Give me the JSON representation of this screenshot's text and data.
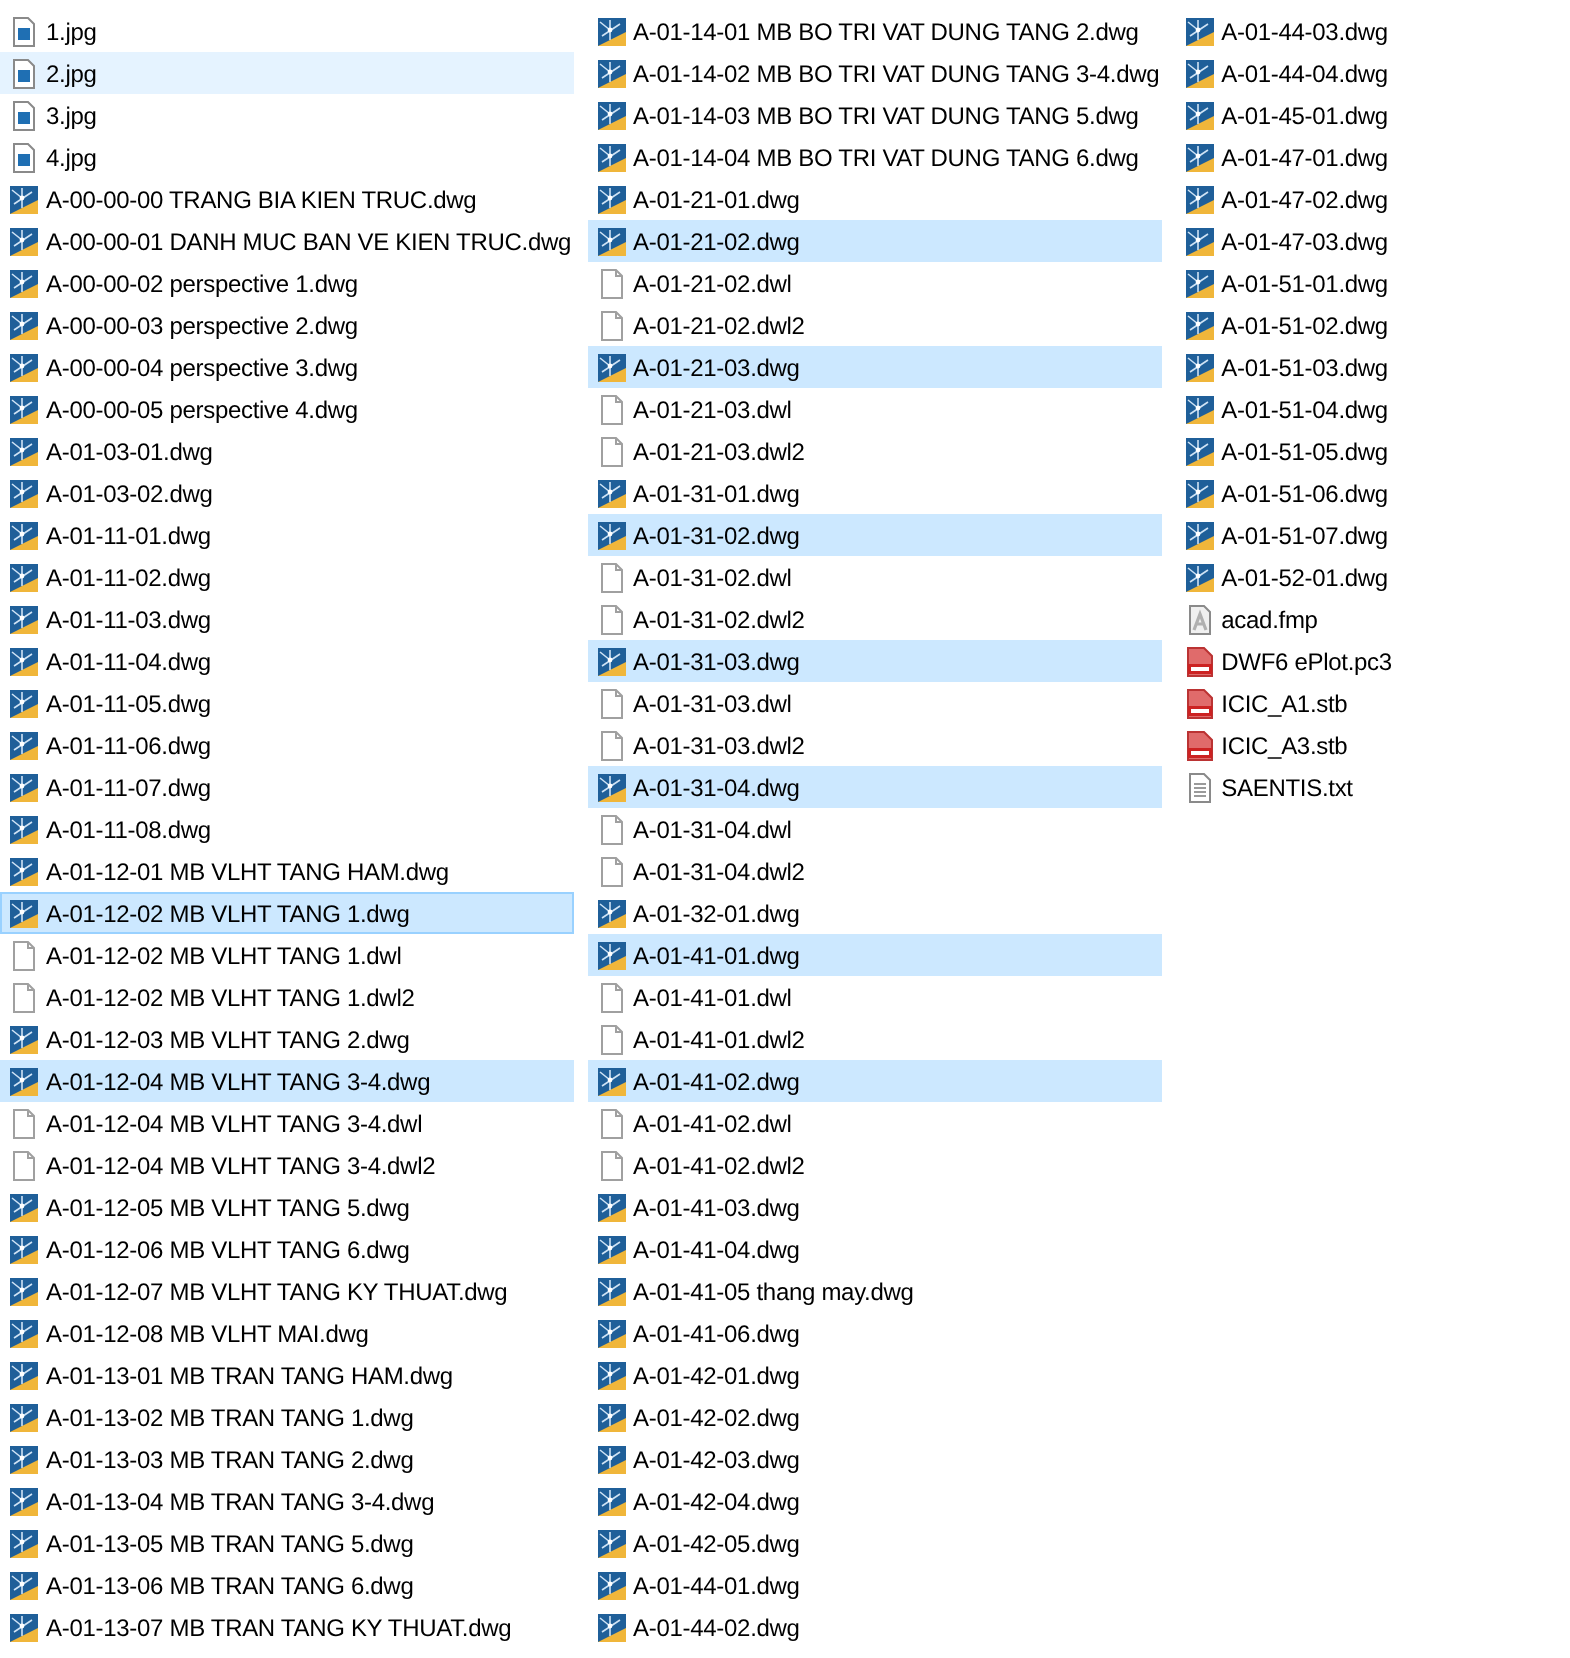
{
  "columns": [
    {
      "items": [
        {
          "name": "1.jpg",
          "kind": "image",
          "selected": false,
          "hovered": false,
          "focused": false
        },
        {
          "name": "2.jpg",
          "kind": "image",
          "selected": false,
          "hovered": true,
          "focused": false
        },
        {
          "name": "3.jpg",
          "kind": "image",
          "selected": false,
          "hovered": false,
          "focused": false
        },
        {
          "name": "4.jpg",
          "kind": "image",
          "selected": false,
          "hovered": false,
          "focused": false
        },
        {
          "name": "A-00-00-00 TRANG BIA KIEN TRUC.dwg",
          "kind": "dwg",
          "selected": false,
          "hovered": false,
          "focused": false
        },
        {
          "name": "A-00-00-01 DANH MUC BAN VE KIEN TRUC.dwg",
          "kind": "dwg",
          "selected": false,
          "hovered": false,
          "focused": false
        },
        {
          "name": "A-00-00-02 perspective 1.dwg",
          "kind": "dwg",
          "selected": false,
          "hovered": false,
          "focused": false
        },
        {
          "name": "A-00-00-03 perspective 2.dwg",
          "kind": "dwg",
          "selected": false,
          "hovered": false,
          "focused": false
        },
        {
          "name": "A-00-00-04 perspective 3.dwg",
          "kind": "dwg",
          "selected": false,
          "hovered": false,
          "focused": false
        },
        {
          "name": "A-00-00-05 perspective 4.dwg",
          "kind": "dwg",
          "selected": false,
          "hovered": false,
          "focused": false
        },
        {
          "name": "A-01-03-01.dwg",
          "kind": "dwg",
          "selected": false,
          "hovered": false,
          "focused": false
        },
        {
          "name": "A-01-03-02.dwg",
          "kind": "dwg",
          "selected": false,
          "hovered": false,
          "focused": false
        },
        {
          "name": "A-01-11-01.dwg",
          "kind": "dwg",
          "selected": false,
          "hovered": false,
          "focused": false
        },
        {
          "name": "A-01-11-02.dwg",
          "kind": "dwg",
          "selected": false,
          "hovered": false,
          "focused": false
        },
        {
          "name": "A-01-11-03.dwg",
          "kind": "dwg",
          "selected": false,
          "hovered": false,
          "focused": false
        },
        {
          "name": "A-01-11-04.dwg",
          "kind": "dwg",
          "selected": false,
          "hovered": false,
          "focused": false
        },
        {
          "name": "A-01-11-05.dwg",
          "kind": "dwg",
          "selected": false,
          "hovered": false,
          "focused": false
        },
        {
          "name": "A-01-11-06.dwg",
          "kind": "dwg",
          "selected": false,
          "hovered": false,
          "focused": false
        },
        {
          "name": "A-01-11-07.dwg",
          "kind": "dwg",
          "selected": false,
          "hovered": false,
          "focused": false
        },
        {
          "name": "A-01-11-08.dwg",
          "kind": "dwg",
          "selected": false,
          "hovered": false,
          "focused": false
        },
        {
          "name": "A-01-12-01 MB VLHT TANG HAM.dwg",
          "kind": "dwg",
          "selected": false,
          "hovered": false,
          "focused": false
        },
        {
          "name": "A-01-12-02 MB VLHT TANG 1.dwg",
          "kind": "dwg",
          "selected": true,
          "hovered": false,
          "focused": true
        },
        {
          "name": "A-01-12-02 MB VLHT TANG 1.dwl",
          "kind": "blank",
          "selected": false,
          "hovered": false,
          "focused": false
        },
        {
          "name": "A-01-12-02 MB VLHT TANG 1.dwl2",
          "kind": "blank",
          "selected": false,
          "hovered": false,
          "focused": false
        },
        {
          "name": "A-01-12-03 MB VLHT TANG 2.dwg",
          "kind": "dwg",
          "selected": false,
          "hovered": false,
          "focused": false
        },
        {
          "name": "A-01-12-04 MB VLHT TANG 3-4.dwg",
          "kind": "dwg",
          "selected": true,
          "hovered": false,
          "focused": false
        },
        {
          "name": "A-01-12-04 MB VLHT TANG 3-4.dwl",
          "kind": "blank",
          "selected": false,
          "hovered": false,
          "focused": false
        },
        {
          "name": "A-01-12-04 MB VLHT TANG 3-4.dwl2",
          "kind": "blank",
          "selected": false,
          "hovered": false,
          "focused": false
        },
        {
          "name": "A-01-12-05 MB VLHT TANG 5.dwg",
          "kind": "dwg",
          "selected": false,
          "hovered": false,
          "focused": false
        },
        {
          "name": "A-01-12-06 MB VLHT TANG 6.dwg",
          "kind": "dwg",
          "selected": false,
          "hovered": false,
          "focused": false
        },
        {
          "name": "A-01-12-07 MB VLHT TANG KY THUAT.dwg",
          "kind": "dwg",
          "selected": false,
          "hovered": false,
          "focused": false
        },
        {
          "name": "A-01-12-08 MB VLHT MAI.dwg",
          "kind": "dwg",
          "selected": false,
          "hovered": false,
          "focused": false
        },
        {
          "name": "A-01-13-01 MB TRAN TANG HAM.dwg",
          "kind": "dwg",
          "selected": false,
          "hovered": false,
          "focused": false
        },
        {
          "name": "A-01-13-02 MB TRAN TANG 1.dwg",
          "kind": "dwg",
          "selected": false,
          "hovered": false,
          "focused": false
        },
        {
          "name": "A-01-13-03 MB TRAN TANG 2.dwg",
          "kind": "dwg",
          "selected": false,
          "hovered": false,
          "focused": false
        },
        {
          "name": "A-01-13-04 MB TRAN TANG 3-4.dwg",
          "kind": "dwg",
          "selected": false,
          "hovered": false,
          "focused": false
        },
        {
          "name": "A-01-13-05 MB TRAN TANG 5.dwg",
          "kind": "dwg",
          "selected": false,
          "hovered": false,
          "focused": false
        },
        {
          "name": "A-01-13-06 MB TRAN TANG 6.dwg",
          "kind": "dwg",
          "selected": false,
          "hovered": false,
          "focused": false
        },
        {
          "name": "A-01-13-07 MB TRAN TANG KY THUAT.dwg",
          "kind": "dwg",
          "selected": false,
          "hovered": false,
          "focused": false
        }
      ]
    },
    {
      "items": [
        {
          "name": "A-01-14-01 MB BO TRI VAT DUNG TANG 2.dwg",
          "kind": "dwg",
          "selected": false,
          "hovered": false,
          "focused": false
        },
        {
          "name": "A-01-14-02 MB BO TRI VAT DUNG TANG 3-4.dwg",
          "kind": "dwg",
          "selected": false,
          "hovered": false,
          "focused": false
        },
        {
          "name": "A-01-14-03 MB BO TRI VAT DUNG TANG 5.dwg",
          "kind": "dwg",
          "selected": false,
          "hovered": false,
          "focused": false
        },
        {
          "name": "A-01-14-04 MB BO TRI VAT DUNG TANG 6.dwg",
          "kind": "dwg",
          "selected": false,
          "hovered": false,
          "focused": false
        },
        {
          "name": "A-01-21-01.dwg",
          "kind": "dwg",
          "selected": false,
          "hovered": false,
          "focused": false
        },
        {
          "name": "A-01-21-02.dwg",
          "kind": "dwg",
          "selected": true,
          "hovered": false,
          "focused": false
        },
        {
          "name": "A-01-21-02.dwl",
          "kind": "blank",
          "selected": false,
          "hovered": false,
          "focused": false
        },
        {
          "name": "A-01-21-02.dwl2",
          "kind": "blank",
          "selected": false,
          "hovered": false,
          "focused": false
        },
        {
          "name": "A-01-21-03.dwg",
          "kind": "dwg",
          "selected": true,
          "hovered": false,
          "focused": false
        },
        {
          "name": "A-01-21-03.dwl",
          "kind": "blank",
          "selected": false,
          "hovered": false,
          "focused": false
        },
        {
          "name": "A-01-21-03.dwl2",
          "kind": "blank",
          "selected": false,
          "hovered": false,
          "focused": false
        },
        {
          "name": "A-01-31-01.dwg",
          "kind": "dwg",
          "selected": false,
          "hovered": false,
          "focused": false
        },
        {
          "name": "A-01-31-02.dwg",
          "kind": "dwg",
          "selected": true,
          "hovered": false,
          "focused": false
        },
        {
          "name": "A-01-31-02.dwl",
          "kind": "blank",
          "selected": false,
          "hovered": false,
          "focused": false
        },
        {
          "name": "A-01-31-02.dwl2",
          "kind": "blank",
          "selected": false,
          "hovered": false,
          "focused": false
        },
        {
          "name": "A-01-31-03.dwg",
          "kind": "dwg",
          "selected": true,
          "hovered": false,
          "focused": false
        },
        {
          "name": "A-01-31-03.dwl",
          "kind": "blank",
          "selected": false,
          "hovered": false,
          "focused": false
        },
        {
          "name": "A-01-31-03.dwl2",
          "kind": "blank",
          "selected": false,
          "hovered": false,
          "focused": false
        },
        {
          "name": "A-01-31-04.dwg",
          "kind": "dwg",
          "selected": true,
          "hovered": false,
          "focused": false
        },
        {
          "name": "A-01-31-04.dwl",
          "kind": "blank",
          "selected": false,
          "hovered": false,
          "focused": false
        },
        {
          "name": "A-01-31-04.dwl2",
          "kind": "blank",
          "selected": false,
          "hovered": false,
          "focused": false
        },
        {
          "name": "A-01-32-01.dwg",
          "kind": "dwg",
          "selected": false,
          "hovered": false,
          "focused": false
        },
        {
          "name": "A-01-41-01.dwg",
          "kind": "dwg",
          "selected": true,
          "hovered": false,
          "focused": false
        },
        {
          "name": "A-01-41-01.dwl",
          "kind": "blank",
          "selected": false,
          "hovered": false,
          "focused": false
        },
        {
          "name": "A-01-41-01.dwl2",
          "kind": "blank",
          "selected": false,
          "hovered": false,
          "focused": false
        },
        {
          "name": "A-01-41-02.dwg",
          "kind": "dwg",
          "selected": true,
          "hovered": false,
          "focused": false
        },
        {
          "name": "A-01-41-02.dwl",
          "kind": "blank",
          "selected": false,
          "hovered": false,
          "focused": false
        },
        {
          "name": "A-01-41-02.dwl2",
          "kind": "blank",
          "selected": false,
          "hovered": false,
          "focused": false
        },
        {
          "name": "A-01-41-03.dwg",
          "kind": "dwg",
          "selected": false,
          "hovered": false,
          "focused": false
        },
        {
          "name": "A-01-41-04.dwg",
          "kind": "dwg",
          "selected": false,
          "hovered": false,
          "focused": false
        },
        {
          "name": "A-01-41-05 thang may.dwg",
          "kind": "dwg",
          "selected": false,
          "hovered": false,
          "focused": false
        },
        {
          "name": "A-01-41-06.dwg",
          "kind": "dwg",
          "selected": false,
          "hovered": false,
          "focused": false
        },
        {
          "name": "A-01-42-01.dwg",
          "kind": "dwg",
          "selected": false,
          "hovered": false,
          "focused": false
        },
        {
          "name": "A-01-42-02.dwg",
          "kind": "dwg",
          "selected": false,
          "hovered": false,
          "focused": false
        },
        {
          "name": "A-01-42-03.dwg",
          "kind": "dwg",
          "selected": false,
          "hovered": false,
          "focused": false
        },
        {
          "name": "A-01-42-04.dwg",
          "kind": "dwg",
          "selected": false,
          "hovered": false,
          "focused": false
        },
        {
          "name": "A-01-42-05.dwg",
          "kind": "dwg",
          "selected": false,
          "hovered": false,
          "focused": false
        },
        {
          "name": "A-01-44-01.dwg",
          "kind": "dwg",
          "selected": false,
          "hovered": false,
          "focused": false
        },
        {
          "name": "A-01-44-02.dwg",
          "kind": "dwg",
          "selected": false,
          "hovered": false,
          "focused": false
        }
      ]
    },
    {
      "items": [
        {
          "name": "A-01-44-03.dwg",
          "kind": "dwg",
          "selected": false,
          "hovered": false,
          "focused": false
        },
        {
          "name": "A-01-44-04.dwg",
          "kind": "dwg",
          "selected": false,
          "hovered": false,
          "focused": false
        },
        {
          "name": "A-01-45-01.dwg",
          "kind": "dwg",
          "selected": false,
          "hovered": false,
          "focused": false
        },
        {
          "name": "A-01-47-01.dwg",
          "kind": "dwg",
          "selected": false,
          "hovered": false,
          "focused": false
        },
        {
          "name": "A-01-47-02.dwg",
          "kind": "dwg",
          "selected": false,
          "hovered": false,
          "focused": false
        },
        {
          "name": "A-01-47-03.dwg",
          "kind": "dwg",
          "selected": false,
          "hovered": false,
          "focused": false
        },
        {
          "name": "A-01-51-01.dwg",
          "kind": "dwg",
          "selected": false,
          "hovered": false,
          "focused": false
        },
        {
          "name": "A-01-51-02.dwg",
          "kind": "dwg",
          "selected": false,
          "hovered": false,
          "focused": false
        },
        {
          "name": "A-01-51-03.dwg",
          "kind": "dwg",
          "selected": false,
          "hovered": false,
          "focused": false
        },
        {
          "name": "A-01-51-04.dwg",
          "kind": "dwg",
          "selected": false,
          "hovered": false,
          "focused": false
        },
        {
          "name": "A-01-51-05.dwg",
          "kind": "dwg",
          "selected": false,
          "hovered": false,
          "focused": false
        },
        {
          "name": "A-01-51-06.dwg",
          "kind": "dwg",
          "selected": false,
          "hovered": false,
          "focused": false
        },
        {
          "name": "A-01-51-07.dwg",
          "kind": "dwg",
          "selected": false,
          "hovered": false,
          "focused": false
        },
        {
          "name": "A-01-52-01.dwg",
          "kind": "dwg",
          "selected": false,
          "hovered": false,
          "focused": false
        },
        {
          "name": "acad.fmp",
          "kind": "font",
          "selected": false,
          "hovered": false,
          "focused": false
        },
        {
          "name": "DWF6 ePlot.pc3",
          "kind": "pc3",
          "selected": false,
          "hovered": false,
          "focused": false
        },
        {
          "name": "ICIC_A1.stb",
          "kind": "stb",
          "selected": false,
          "hovered": false,
          "focused": false
        },
        {
          "name": "ICIC_A3.stb",
          "kind": "stb",
          "selected": false,
          "hovered": false,
          "focused": false
        },
        {
          "name": "SAENTIS.txt",
          "kind": "text",
          "selected": false,
          "hovered": false,
          "focused": false
        }
      ]
    }
  ]
}
